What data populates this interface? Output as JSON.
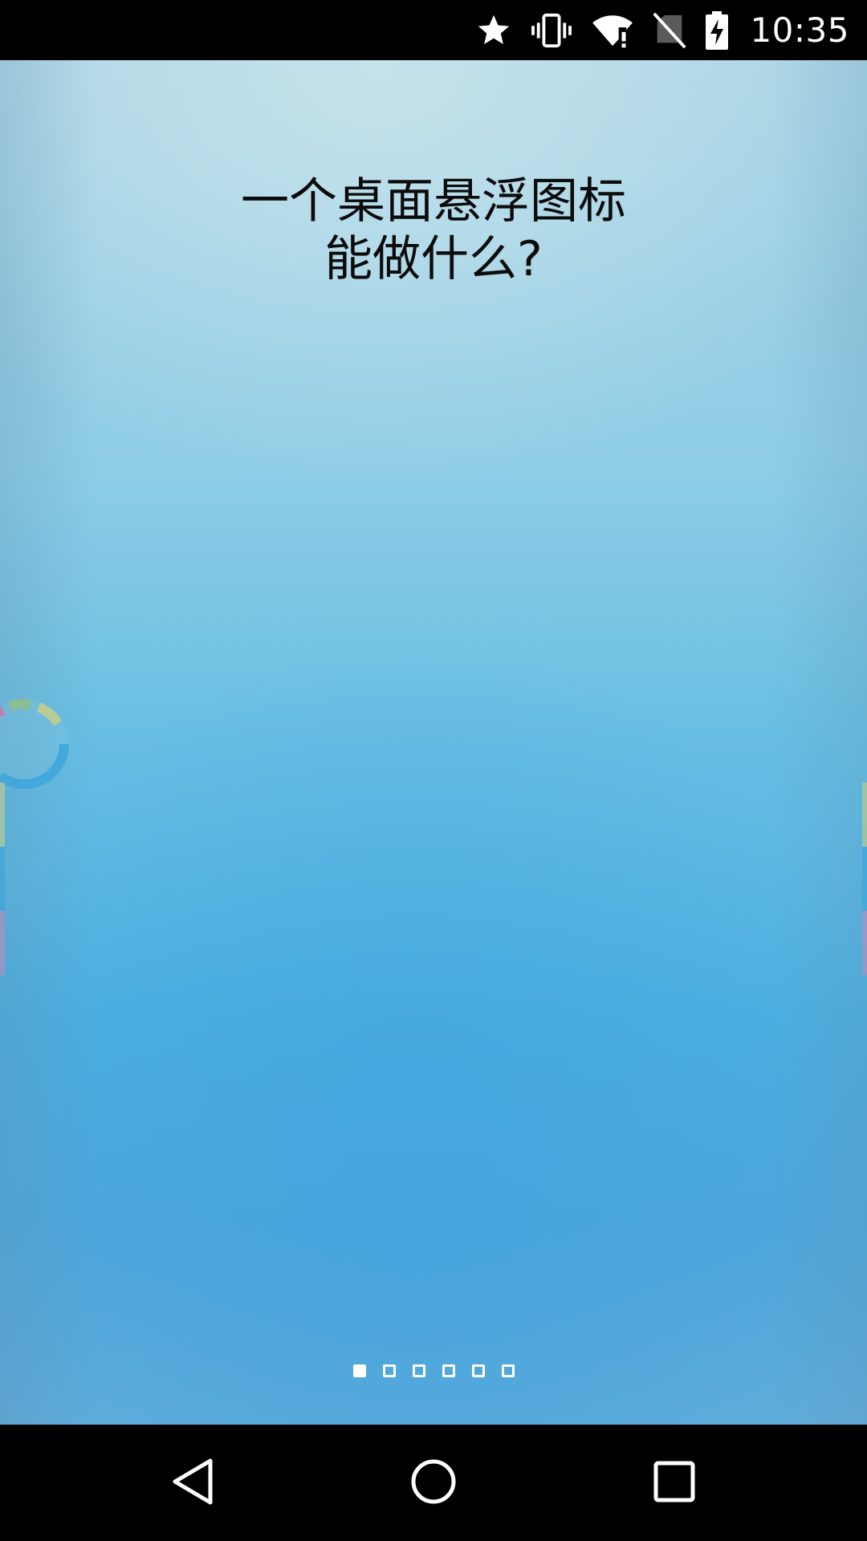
{
  "status_bar": {
    "time": "10:35",
    "icons": [
      "star-icon",
      "vibrate-icon",
      "wifi-alert-icon",
      "no-sim-icon",
      "battery-charging-icon"
    ]
  },
  "intro": {
    "title_line1": "一个桌面悬浮图标",
    "title_line2": "能做什么?"
  },
  "pager": {
    "total_pages": 6,
    "current_page": 1
  },
  "nav_bar": {
    "icons": [
      "back-icon",
      "home-icon",
      "recents-icon"
    ]
  },
  "colors": {
    "status_bar_bg": "#000000",
    "background_top": "#a6d2e4",
    "background_bottom": "#4fa8dc",
    "title_text": "#0b0b0b",
    "indicator": "#ffffff",
    "ring_blue": "#3ca4dc",
    "ring_green": "#8fbf86",
    "ring_yellow": "#c6cf8a",
    "ring_pink": "#d96aa6"
  }
}
